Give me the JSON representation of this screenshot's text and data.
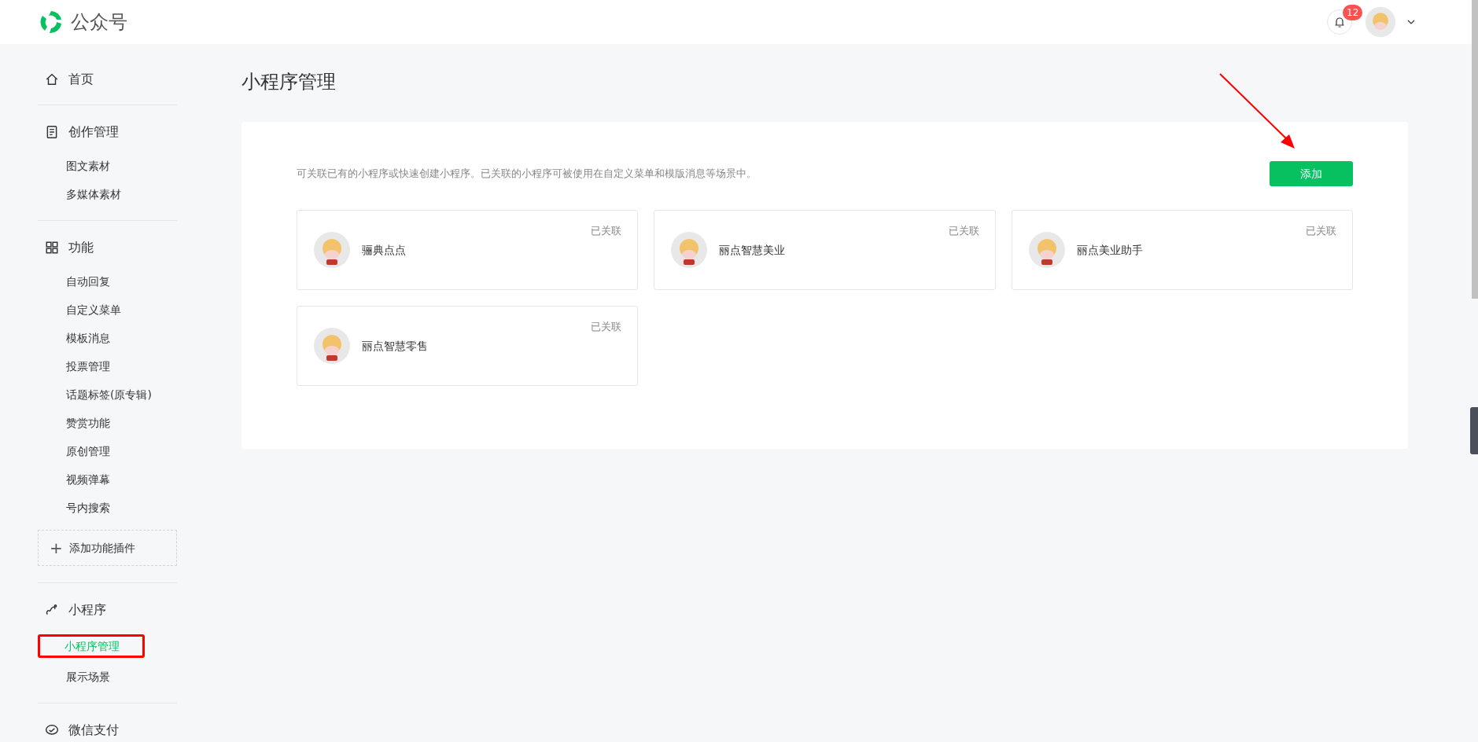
{
  "header": {
    "logo_text": "公众号",
    "notifications": {
      "count": "12"
    }
  },
  "sidebar": {
    "sections": [
      {
        "title": "首页",
        "kind": "home"
      },
      {
        "title": "创作管理",
        "kind": "doc",
        "items": [
          {
            "label": "图文素材",
            "selected": false
          },
          {
            "label": "多媒体素材",
            "selected": false
          }
        ]
      },
      {
        "title": "功能",
        "kind": "grid",
        "items": [
          {
            "label": "自动回复",
            "selected": false
          },
          {
            "label": "自定义菜单",
            "selected": false
          },
          {
            "label": "模板消息",
            "selected": false
          },
          {
            "label": "投票管理",
            "selected": false
          },
          {
            "label": "话题标签(原专辑)",
            "selected": false
          },
          {
            "label": "赞赏功能",
            "selected": false
          },
          {
            "label": "原创管理",
            "selected": false
          },
          {
            "label": "视频弹幕",
            "selected": false
          },
          {
            "label": "号内搜索",
            "selected": false
          }
        ],
        "add_plugin": {
          "icon": "+",
          "label": "添加功能插件"
        }
      },
      {
        "title": "小程序",
        "kind": "link",
        "items": [
          {
            "label": "小程序管理",
            "selected": true,
            "annotated": true
          },
          {
            "label": "展示场景",
            "selected": false
          }
        ]
      },
      {
        "title": "微信支付",
        "kind": "chat"
      }
    ]
  },
  "page": {
    "title": "小程序管理",
    "description": "可关联已有的小程序或快速创建小程序。已关联的小程序可被使用在自定义菜单和模版消息等场景中。",
    "add_button": "添加",
    "annotation_arrow": true,
    "mini_programs": [
      {
        "name": "骊典点点",
        "status": "已关联"
      },
      {
        "name": "丽点智慧美业",
        "status": "已关联"
      },
      {
        "name": "丽点美业助手",
        "status": "已关联"
      },
      {
        "name": "丽点智慧零售",
        "status": "已关联"
      }
    ]
  }
}
